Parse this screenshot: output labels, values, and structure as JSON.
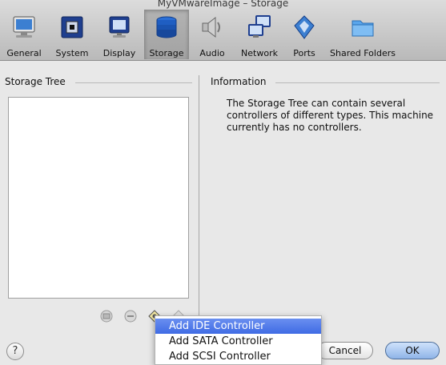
{
  "window": {
    "title": "MyVMwareImage – Storage"
  },
  "toolbar": {
    "items": [
      {
        "label": "General",
        "icon": "monitor-icon"
      },
      {
        "label": "System",
        "icon": "chip-icon"
      },
      {
        "label": "Display",
        "icon": "display-icon"
      },
      {
        "label": "Storage",
        "icon": "disk-stack-icon",
        "selected": true
      },
      {
        "label": "Audio",
        "icon": "speaker-icon"
      },
      {
        "label": "Network",
        "icon": "network-icon"
      },
      {
        "label": "Ports",
        "icon": "ports-icon"
      },
      {
        "label": "Shared Folders",
        "icon": "folder-icon"
      }
    ]
  },
  "storage_tree": {
    "title": "Storage Tree",
    "buttons": [
      "add-controller-icon",
      "remove-controller-icon",
      "add-attachment-icon",
      "remove-attachment-icon"
    ]
  },
  "information": {
    "title": "Information",
    "text": "The Storage Tree can contain several controllers of different types. This machine currently has no controllers."
  },
  "buttons": {
    "help": "?",
    "cancel": "Cancel",
    "ok": "OK"
  },
  "popup_menu": {
    "items": [
      "Add IDE Controller",
      "Add SATA Controller",
      "Add SCSI Controller"
    ],
    "highlighted": "Add IDE Controller"
  },
  "colors": {
    "accent": "#3f6be4",
    "ok_button": "#8fb4e8"
  }
}
